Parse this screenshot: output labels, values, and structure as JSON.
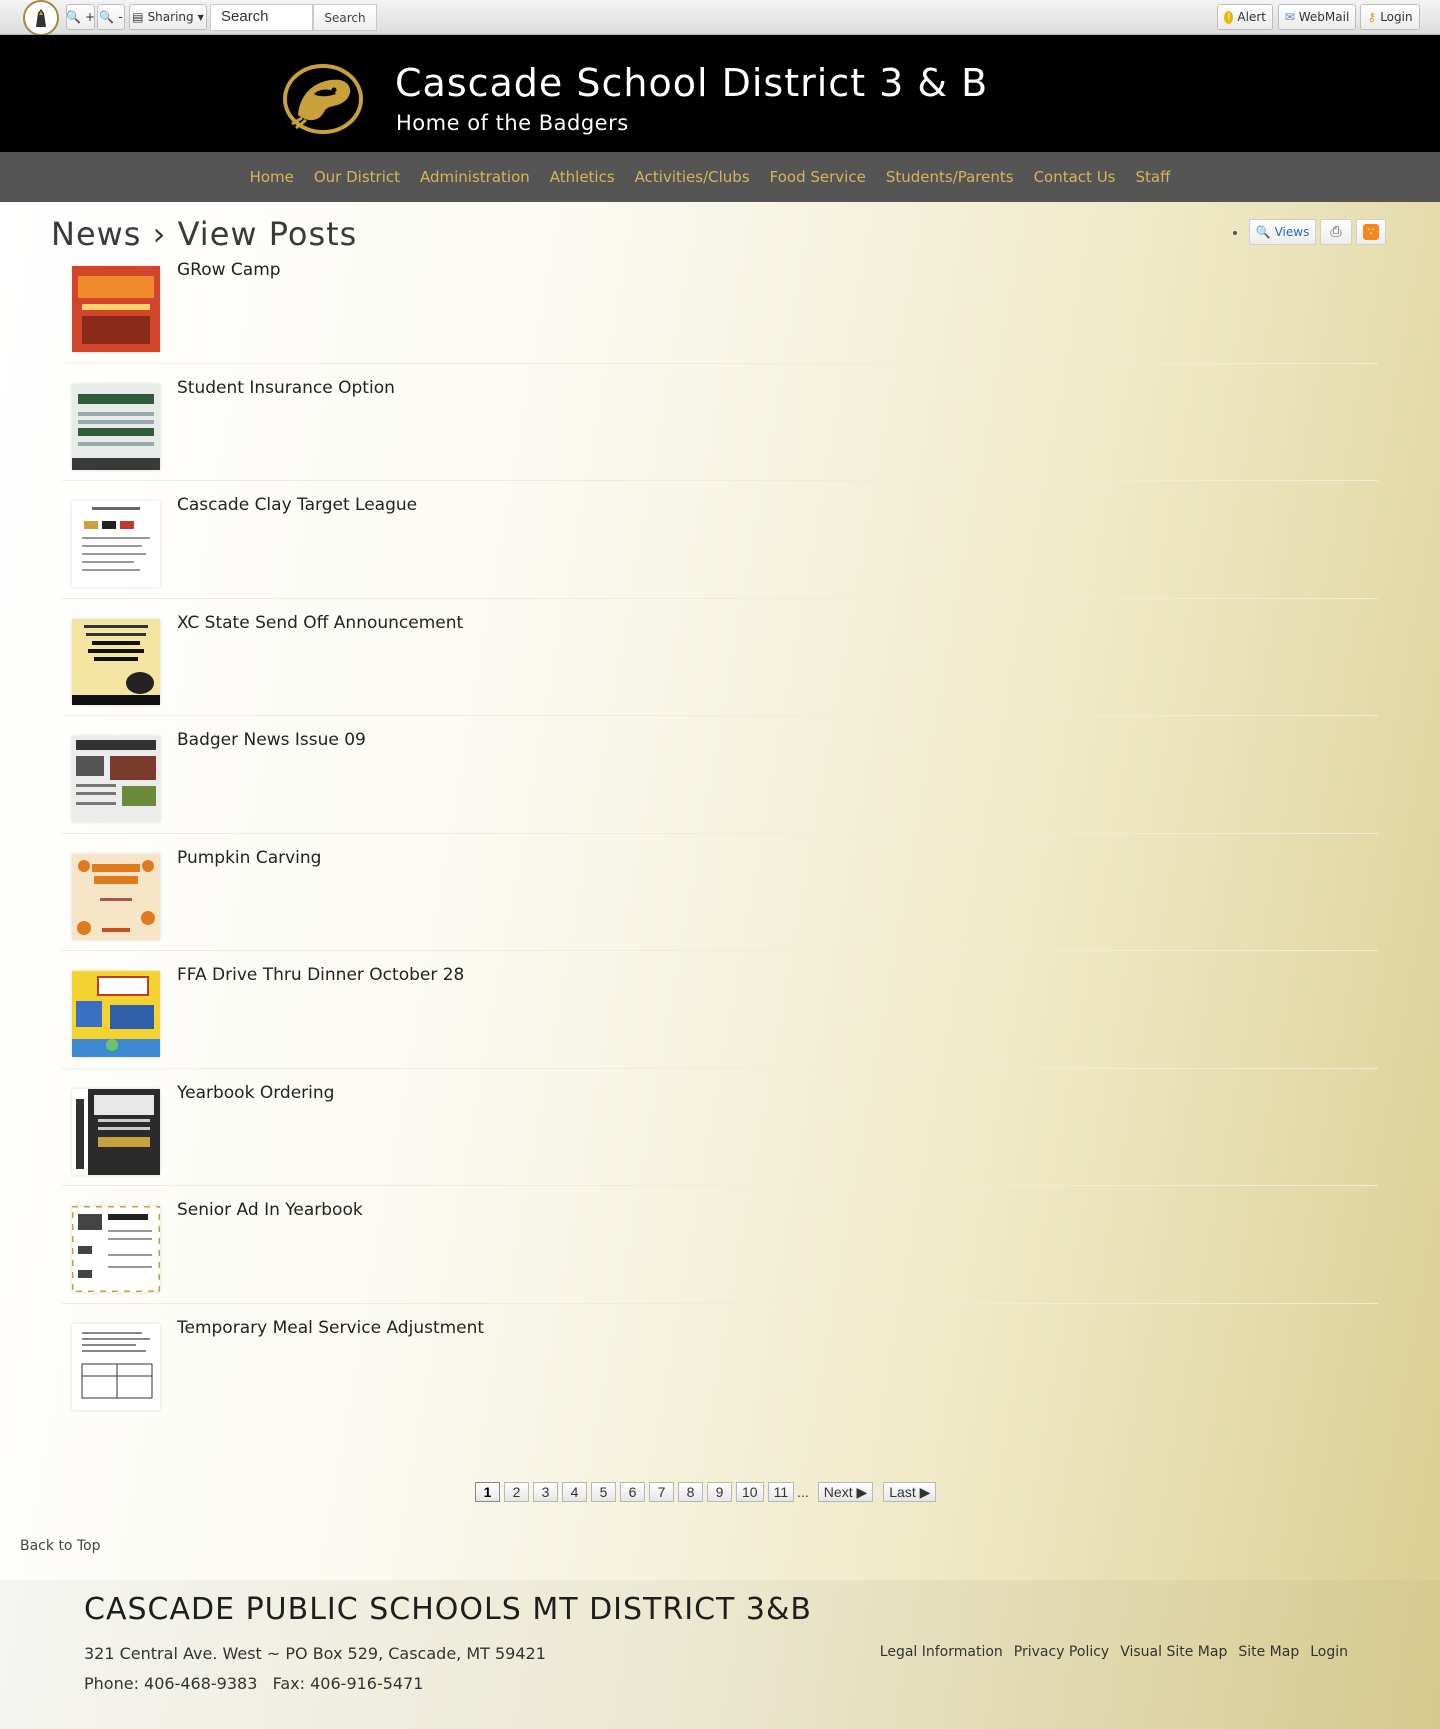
{
  "utility_bar": {
    "sharing_label": "Sharing",
    "zoom_in_label": "+",
    "zoom_out_label": "-",
    "search_value": "Search",
    "search_button": "Search",
    "alert_label": "Alert",
    "webmail_label": "WebMail",
    "login_label": "Login"
  },
  "banner": {
    "title": "Cascade School District 3 & B",
    "subtitle": "Home of the Badgers"
  },
  "nav": {
    "items": [
      "Home",
      "Our District",
      "Administration",
      "Athletics",
      "Activities/Clubs",
      "Food Service",
      "Students/Parents",
      "Contact Us",
      "Staff"
    ]
  },
  "page": {
    "heading": "News › View Posts",
    "views_label": "Views"
  },
  "posts": [
    {
      "title": "GRow Camp",
      "thumb_color": "#d2452a"
    },
    {
      "title": "Student Insurance Option",
      "thumb_color": "#2f5d3a"
    },
    {
      "title": "Cascade Clay Target League",
      "thumb_color": "#ffffff"
    },
    {
      "title": "XC State Send Off Announcement",
      "thumb_color": "#f3e4a1"
    },
    {
      "title": "Badger News Issue 09",
      "thumb_color": "#e9e9e9"
    },
    {
      "title": "Pumpkin Carving",
      "thumb_color": "#f6e6c7"
    },
    {
      "title": "FFA Drive Thru Dinner October 28",
      "thumb_color": "#f4d331"
    },
    {
      "title": "Yearbook Ordering",
      "thumb_color": "#2b2b2b"
    },
    {
      "title": "Senior Ad In Yearbook",
      "thumb_color": "#ffffff"
    },
    {
      "title": "Temporary Meal Service Adjustment",
      "thumb_color": "#ffffff"
    }
  ],
  "pagination": {
    "pages": [
      "1",
      "2",
      "3",
      "4",
      "5",
      "6",
      "7",
      "8",
      "9",
      "10",
      "11"
    ],
    "current": "1",
    "ellipsis": "...",
    "next_label": "Next ▶",
    "last_label": "Last ▶"
  },
  "back_to_top": "Back to Top",
  "footer": {
    "title": "CASCADE PUBLIC SCHOOLS MT DISTRICT 3&B",
    "address": "321 Central Ave. West ~ PO Box 529, Cascade, MT 59421",
    "phone": "Phone: 406-468-9383   Fax: 406-916-5471",
    "links": [
      "Legal Information",
      "Privacy Policy",
      "Visual Site Map",
      "Site Map",
      "Login"
    ]
  },
  "colors": {
    "nav_link": "#d8b45a",
    "nav_bg": "#555555",
    "banner_bg": "#000000",
    "accent_gold": "#c9a13a"
  }
}
